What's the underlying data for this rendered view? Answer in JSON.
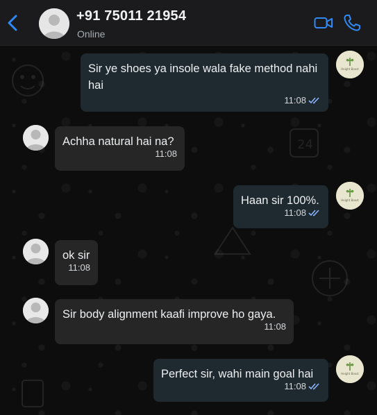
{
  "header": {
    "contact_name": "+91 75011 21954",
    "status": "Online"
  },
  "brand_logo_text": "Height Boost",
  "messages": [
    {
      "direction": "out",
      "text": "Sir ye shoes ya insole wala fake method nahi hai",
      "time": "11:08",
      "read": true
    },
    {
      "direction": "in",
      "text": "Achha natural hai na?",
      "time": "11:08"
    },
    {
      "direction": "out",
      "text": "Haan sir 100%.",
      "time": "11:08",
      "read": true
    },
    {
      "direction": "in",
      "text": "ok sir",
      "time": "11:08"
    },
    {
      "direction": "in",
      "text": "Sir body alignment kaafi improve ho gaya.",
      "time": "11:08"
    },
    {
      "direction": "out",
      "text": "Perfect sir, wahi main goal hai",
      "time": "11:08",
      "read": true
    }
  ],
  "colors": {
    "accent": "#2f8af5",
    "read_ticks": "#8ab4ff",
    "outgoing_bubble": "#1f2a30",
    "incoming_bubble": "#262626"
  },
  "icons": [
    "back-icon",
    "video-call-icon",
    "voice-call-icon",
    "default-avatar-icon",
    "read-ticks-icon"
  ]
}
